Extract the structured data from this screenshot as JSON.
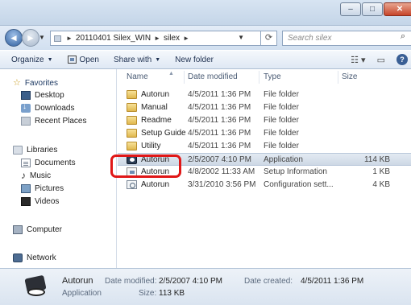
{
  "window": {
    "minimize_glyph": "–",
    "maximize_glyph": "□",
    "close_glyph": "✕"
  },
  "address": {
    "back_glyph": "◄",
    "forward_glyph": "►",
    "breadcrumb": [
      "20110401 Silex_WIN",
      "silex"
    ],
    "search_placeholder": "Search silex"
  },
  "toolbar": {
    "organize": "Organize",
    "open": "Open",
    "share_with": "Share with",
    "new_folder": "New folder"
  },
  "nav": {
    "favorites": "Favorites",
    "desktop": "Desktop",
    "downloads": "Downloads",
    "recent_places": "Recent Places",
    "libraries": "Libraries",
    "documents": "Documents",
    "music": "Music",
    "pictures": "Pictures",
    "videos": "Videos",
    "computer": "Computer",
    "network": "Network"
  },
  "columns": {
    "name": "Name",
    "date_modified": "Date modified",
    "type": "Type",
    "size": "Size"
  },
  "files": [
    {
      "name": "Autorun",
      "date": "4/5/2011 1:36 PM",
      "type": "File folder",
      "size": "",
      "icon": "folder-icon"
    },
    {
      "name": "Manual",
      "date": "4/5/2011 1:36 PM",
      "type": "File folder",
      "size": "",
      "icon": "folder-icon"
    },
    {
      "name": "Readme",
      "date": "4/5/2011 1:36 PM",
      "type": "File folder",
      "size": "",
      "icon": "folder-icon"
    },
    {
      "name": "Setup Guide",
      "date": "4/5/2011 1:36 PM",
      "type": "File folder",
      "size": "",
      "icon": "folder-icon"
    },
    {
      "name": "Utility",
      "date": "4/5/2011 1:36 PM",
      "type": "File folder",
      "size": "",
      "icon": "folder-icon"
    },
    {
      "name": "Autorun",
      "date": "2/5/2007 4:10 PM",
      "type": "Application",
      "size": "114 KB",
      "icon": "application-icon"
    },
    {
      "name": "Autorun",
      "date": "4/8/2002 11:33 AM",
      "type": "Setup Information",
      "size": "1 KB",
      "icon": "setup-information-icon"
    },
    {
      "name": "Autorun",
      "date": "3/31/2010 3:56 PM",
      "type": "Configuration sett...",
      "size": "4 KB",
      "icon": "configuration-icon"
    }
  ],
  "details": {
    "name": "Autorun",
    "type": "Application",
    "date_modified_label": "Date modified:",
    "date_modified": "2/5/2007 4:10 PM",
    "size_label": "Size:",
    "size": "113 KB",
    "date_created_label": "Date created:",
    "date_created": "4/5/2011 1:36 PM"
  },
  "colors": {
    "highlight_box": "#e01717",
    "selection": "#d5dfea"
  }
}
